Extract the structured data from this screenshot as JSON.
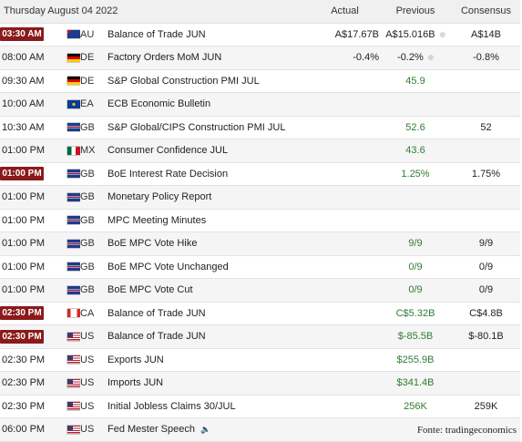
{
  "header": {
    "date": "Thursday August 04 2022",
    "actual": "Actual",
    "previous": "Previous",
    "consensus": "Consensus"
  },
  "rows": [
    {
      "time": "03:30 AM",
      "highlight": true,
      "country": "AU",
      "event": "Balance of Trade JUN",
      "actual": "A$17.67B",
      "previous": "A$15.016B",
      "previous_revised": true,
      "consensus": "A$14B"
    },
    {
      "time": "08:00 AM",
      "highlight": false,
      "country": "DE",
      "event": "Factory Orders MoM JUN",
      "actual": "-0.4%",
      "previous": "-0.2%",
      "previous_revised": true,
      "consensus": "-0.8%"
    },
    {
      "time": "09:30 AM",
      "highlight": false,
      "country": "DE",
      "event": "S&P Global Construction PMI JUL",
      "actual": "",
      "previous": "45.9",
      "consensus": ""
    },
    {
      "time": "10:00 AM",
      "highlight": false,
      "country": "EA",
      "event": "ECB Economic Bulletin",
      "actual": "",
      "previous": "",
      "consensus": ""
    },
    {
      "time": "10:30 AM",
      "highlight": false,
      "country": "GB",
      "event": "S&P Global/CIPS Construction PMI JUL",
      "actual": "",
      "previous": "52.6",
      "consensus": "52"
    },
    {
      "time": "01:00 PM",
      "highlight": false,
      "country": "MX",
      "event": "Consumer Confidence JUL",
      "actual": "",
      "previous": "43.6",
      "consensus": ""
    },
    {
      "time": "01:00 PM",
      "highlight": true,
      "country": "GB",
      "event": "BoE Interest Rate Decision",
      "actual": "",
      "previous": "1.25%",
      "consensus": "1.75%"
    },
    {
      "time": "01:00 PM",
      "highlight": false,
      "country": "GB",
      "event": "Monetary Policy Report",
      "actual": "",
      "previous": "",
      "consensus": ""
    },
    {
      "time": "01:00 PM",
      "highlight": false,
      "country": "GB",
      "event": "MPC Meeting Minutes",
      "actual": "",
      "previous": "",
      "consensus": ""
    },
    {
      "time": "01:00 PM",
      "highlight": false,
      "country": "GB",
      "event": "BoE MPC Vote Hike",
      "actual": "",
      "previous": "9/9",
      "consensus": "9/9"
    },
    {
      "time": "01:00 PM",
      "highlight": false,
      "country": "GB",
      "event": "BoE MPC Vote Unchanged",
      "actual": "",
      "previous": "0/9",
      "consensus": "0/9"
    },
    {
      "time": "01:00 PM",
      "highlight": false,
      "country": "GB",
      "event": "BoE MPC Vote Cut",
      "actual": "",
      "previous": "0/9",
      "consensus": "0/9"
    },
    {
      "time": "02:30 PM",
      "highlight": true,
      "country": "CA",
      "event": "Balance of Trade JUN",
      "actual": "",
      "previous": "C$5.32B",
      "consensus": "C$4.8B"
    },
    {
      "time": "02:30 PM",
      "highlight": true,
      "country": "US",
      "event": "Balance of Trade JUN",
      "actual": "",
      "previous": "$-85.5B",
      "consensus": "$-80.1B"
    },
    {
      "time": "02:30 PM",
      "highlight": false,
      "country": "US",
      "event": "Exports JUN",
      "actual": "",
      "previous": "$255.9B",
      "consensus": ""
    },
    {
      "time": "02:30 PM",
      "highlight": false,
      "country": "US",
      "event": "Imports JUN",
      "actual": "",
      "previous": "$341.4B",
      "consensus": ""
    },
    {
      "time": "02:30 PM",
      "highlight": false,
      "country": "US",
      "event": "Initial Jobless Claims 30/JUL",
      "actual": "",
      "previous": "256K",
      "consensus": "259K"
    },
    {
      "time": "06:00 PM",
      "highlight": false,
      "country": "US",
      "event": "Fed Mester Speech",
      "speaker_icon": true,
      "actual": "",
      "previous": "",
      "consensus": ""
    }
  ],
  "source": "Fonte: tradingeconomics",
  "colors": {
    "highlight_badge": "#8b1a1a",
    "previous_text": "#2e7d32",
    "header_bg": "#f0f0f0",
    "row_alt_bg": "#f5f5f5"
  },
  "icons": {
    "revised": "revised-icon",
    "speaker": "speaker-icon"
  }
}
